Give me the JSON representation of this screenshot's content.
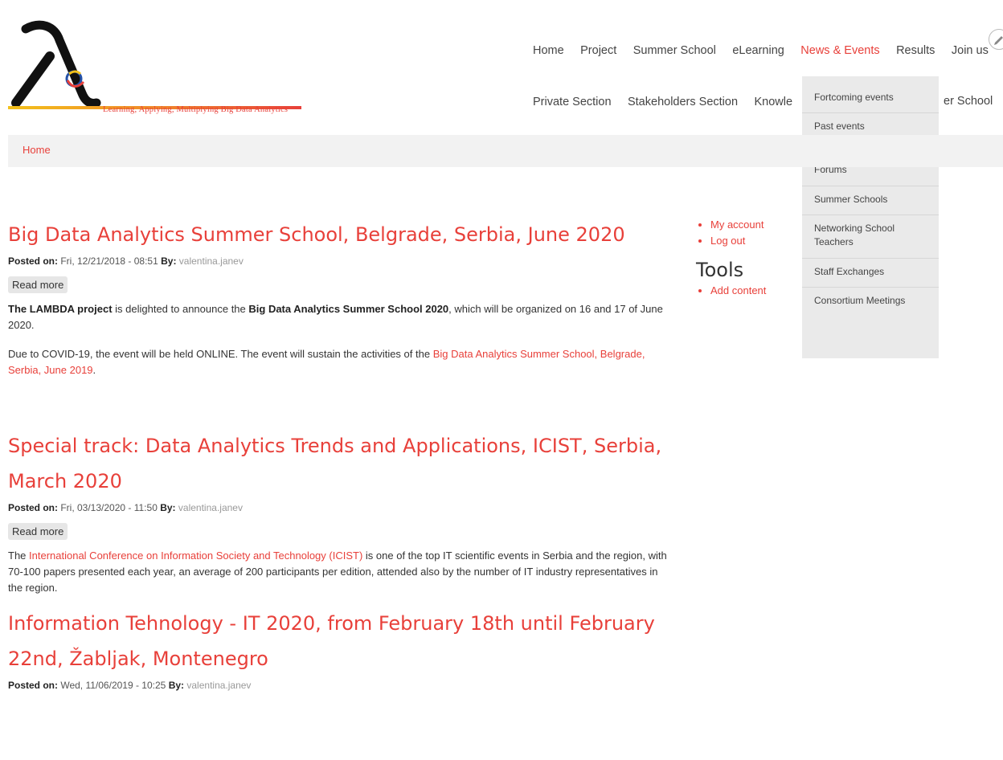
{
  "site": {
    "tagline": "Learning, Applying, Multiplying Big Data Analytics"
  },
  "nav": {
    "row1": [
      "Home",
      "Project",
      "Summer School",
      "eLearning",
      "News & Events",
      "Results",
      "Join us"
    ],
    "row2": [
      "Private Section",
      "Stakeholders Section",
      "Knowle",
      "er School"
    ],
    "active": "News & Events"
  },
  "dropdown": {
    "items": [
      "Fortcoming events",
      "Past events",
      "Research-Industry Forums",
      "Summer Schools",
      "Networking School Teachers",
      "Staff Exchanges",
      "Consortium Meetings"
    ]
  },
  "breadcrumb": {
    "home": "Home"
  },
  "articles": [
    {
      "title": "Big Data Analytics Summer School, Belgrade, Serbia, June 2020",
      "posted_label": "Posted on:",
      "posted_date": "Fri, 12/21/2018 - 08:51",
      "by_label": "By:",
      "author": "valentina.janev",
      "read_more": "Read more",
      "p1_bold1": "The LAMBDA project",
      "p1_text1": " is delighted to announce the ",
      "p1_bold2": "Big Data Analytics Summer School 2020",
      "p1_text2": ", which will be organized on 16 and 17 of June 2020.",
      "p2_text": "Due to COVID-19, the event will be held ONLINE.  The event will sustain the activities of the ",
      "p2_link": "Big Data Analytics Summer School, Belgrade, Serbia, June 2019",
      "p2_end": "."
    },
    {
      "title": "Special track: Data Analytics Trends and Applications, ICIST, Serbia, March 2020",
      "posted_label": "Posted on:",
      "posted_date": "Fri, 03/13/2020 - 11:50",
      "by_label": "By:",
      "author": "valentina.janev",
      "read_more": "Read more",
      "p1_text1": "The ",
      "p1_link": "International Conference on Information Society and Technology (ICIST)",
      "p1_text2": " is one of the top IT scientific events in Serbia and the region, with 70-100 papers presented each year, an average of 200 participants per edition, attended also by the number of IT industry representatives in the region."
    },
    {
      "title": "Information Tehnology - IT 2020, from February 18th until February 22nd, Žabljak, Montenegro",
      "posted_label": "Posted on:",
      "posted_date": "Wed, 11/06/2019 - 10:25",
      "by_label": "By:",
      "author": "valentina.janev"
    }
  ],
  "sidebar": {
    "user_links": [
      "My account",
      "Log out"
    ],
    "tools_heading": "Tools",
    "tools_links": [
      "Add content"
    ]
  },
  "colors": {
    "accent": "#e8403a",
    "logo_black": "#111111",
    "logo_yellow": "#f3c11b",
    "logo_blue": "#2451a8"
  }
}
